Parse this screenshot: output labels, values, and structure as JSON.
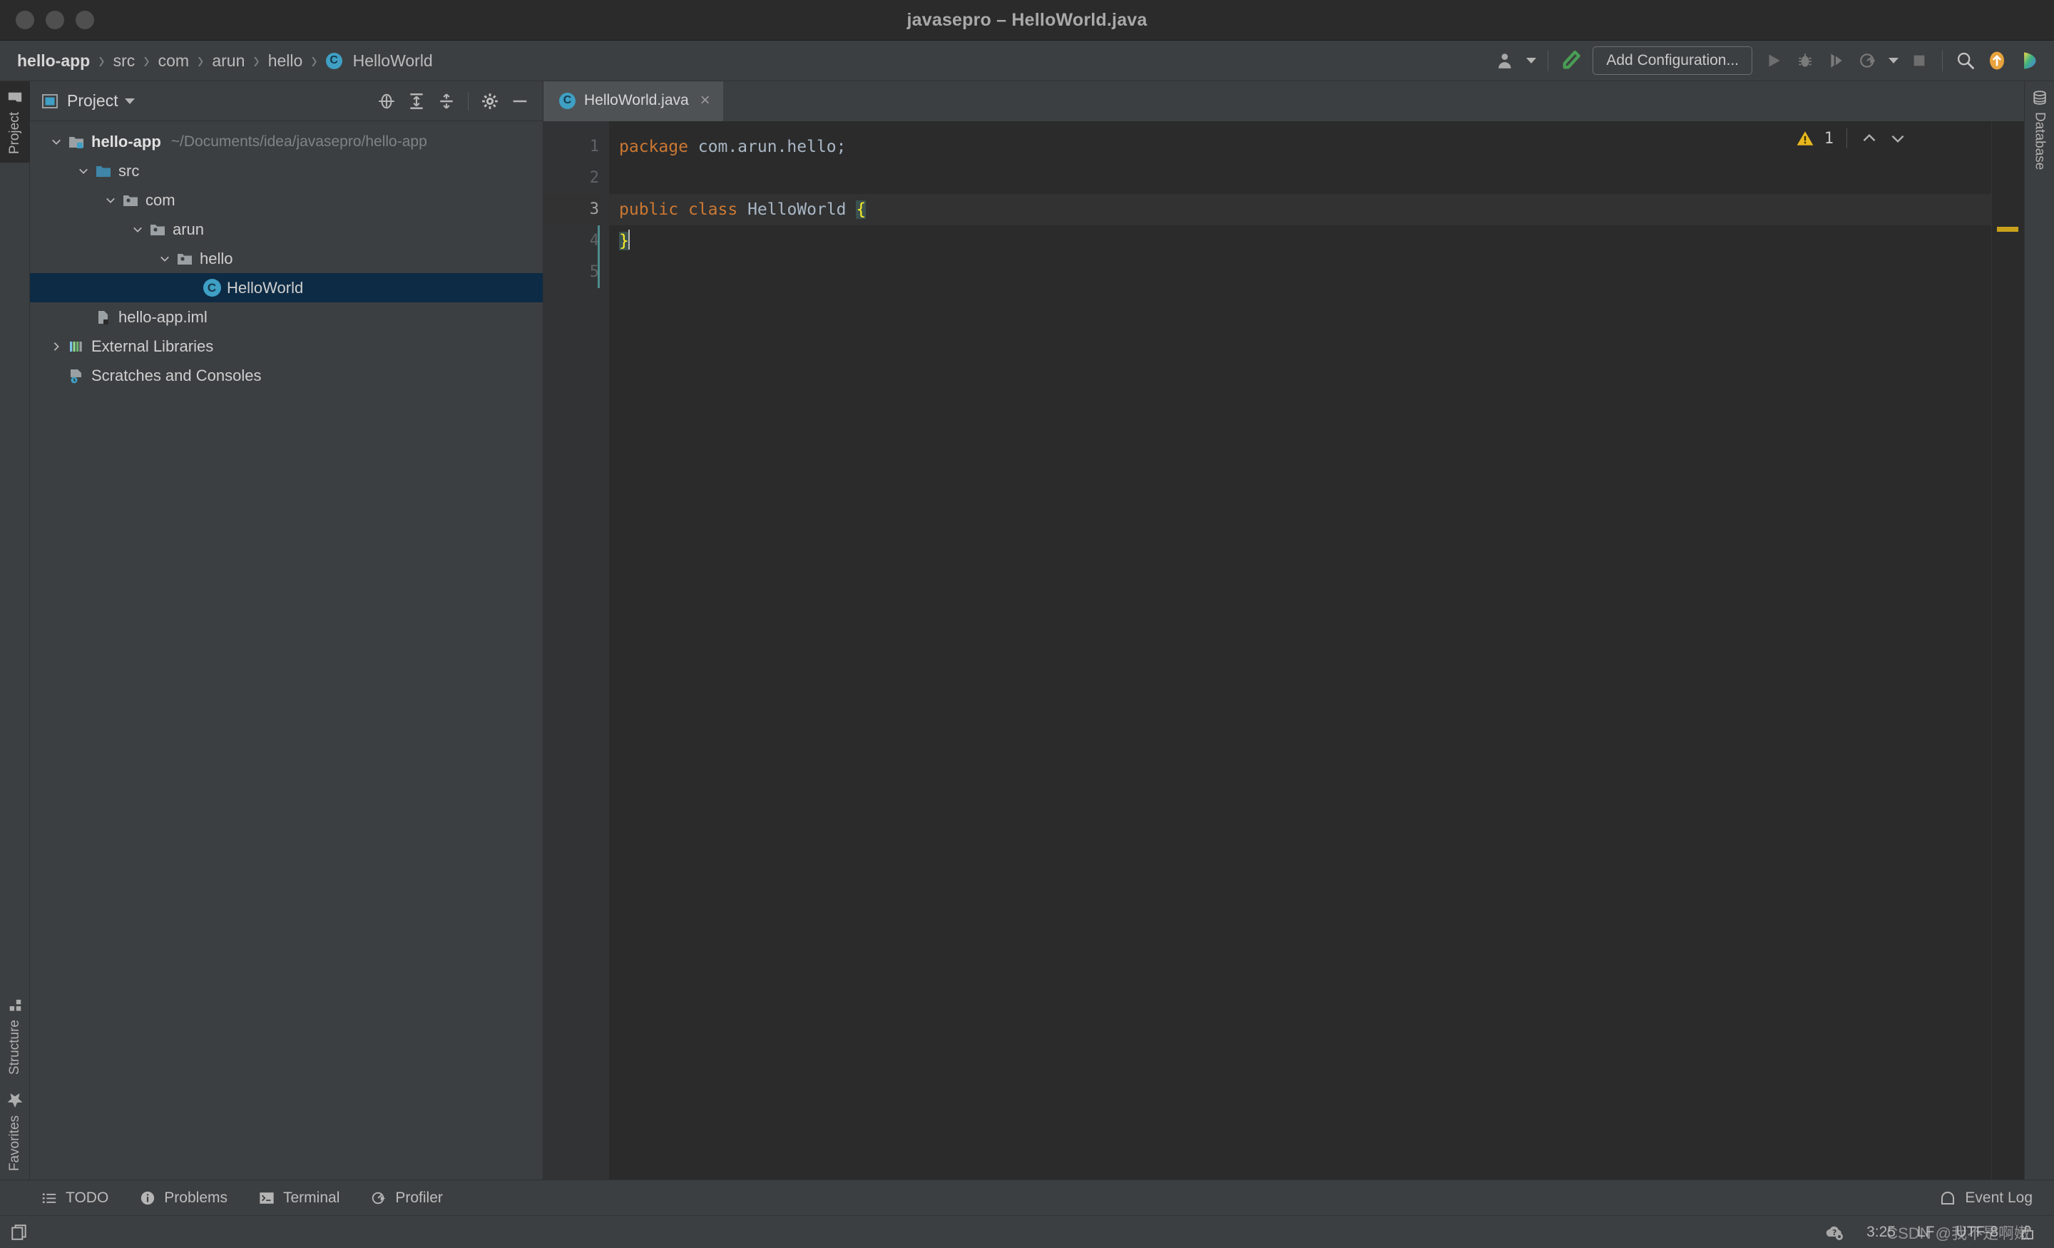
{
  "window": {
    "title": "javasepro – HelloWorld.java",
    "traffic_lights": [
      "close",
      "minimize",
      "zoom"
    ]
  },
  "breadcrumb": {
    "items": [
      {
        "label": "hello-app",
        "icon": "none",
        "bold": true
      },
      {
        "label": "src",
        "icon": "none",
        "bold": false
      },
      {
        "label": "com",
        "icon": "none",
        "bold": false
      },
      {
        "label": "arun",
        "icon": "none",
        "bold": false
      },
      {
        "label": "hello",
        "icon": "none",
        "bold": false
      },
      {
        "label": "HelloWorld",
        "icon": "class-badge",
        "bold": false
      }
    ],
    "separator": "›",
    "class_badge_letter": "C"
  },
  "toolbar": {
    "account_label": "account-icon",
    "build_label": "build-hammer-icon",
    "add_configuration": "Add Configuration...",
    "run_label": "run-icon",
    "debug_label": "debug-icon",
    "run_coverage_label": "run-with-coverage-icon",
    "profile_label": "profile-icon",
    "stop_label": "stop-icon",
    "search_label": "search-everywhere-icon",
    "update_label": "update-icon",
    "ide_label": "ide-icon",
    "accent_green": "#499c54",
    "accent_orange": "#e8a33d"
  },
  "left_stripe": {
    "top": [
      {
        "label": "Project",
        "icon": "folder-icon",
        "active": true
      }
    ],
    "bottom": [
      {
        "label": "Structure",
        "icon": "structure-icon",
        "active": false
      },
      {
        "label": "Favorites",
        "icon": "star-icon",
        "active": false
      }
    ]
  },
  "right_stripe": {
    "items": [
      {
        "label": "Database",
        "icon": "database-icon",
        "active": false
      }
    ]
  },
  "project_panel": {
    "title": "Project",
    "icons": [
      "locate-icon",
      "expand-all-icon",
      "collapse-all-icon",
      "settings-gear-icon",
      "hide-icon"
    ],
    "tree": [
      {
        "label": "hello-app",
        "path": "~/Documents/idea/javasepro/hello-app",
        "icon": "module-icon",
        "depth": 0,
        "arrow": "down",
        "bold": true,
        "selected": false
      },
      {
        "label": "src",
        "path": "",
        "icon": "source-folder-icon",
        "depth": 1,
        "arrow": "down",
        "bold": false,
        "selected": false
      },
      {
        "label": "com",
        "path": "",
        "icon": "package-icon",
        "depth": 2,
        "arrow": "down",
        "bold": false,
        "selected": false
      },
      {
        "label": "arun",
        "path": "",
        "icon": "package-icon",
        "depth": 3,
        "arrow": "down",
        "bold": false,
        "selected": false
      },
      {
        "label": "hello",
        "path": "",
        "icon": "package-icon",
        "depth": 4,
        "arrow": "down",
        "bold": false,
        "selected": false
      },
      {
        "label": "HelloWorld",
        "path": "",
        "icon": "class-icon",
        "depth": 5,
        "arrow": "none",
        "bold": false,
        "selected": true
      },
      {
        "label": "hello-app.iml",
        "path": "",
        "icon": "iml-file-icon",
        "depth": 1,
        "arrow": "none",
        "bold": false,
        "selected": false
      },
      {
        "label": "External Libraries",
        "path": "",
        "icon": "libraries-icon",
        "depth": 0,
        "arrow": "right",
        "bold": false,
        "selected": false
      },
      {
        "label": "Scratches and Consoles",
        "path": "",
        "icon": "scratches-icon",
        "depth": 0,
        "arrow": "none",
        "bold": false,
        "selected": false
      }
    ]
  },
  "editor": {
    "tabs": [
      {
        "label": "HelloWorld.java",
        "icon": "class-icon",
        "badge": "C",
        "close": "×",
        "active": true
      }
    ],
    "line_numbers": [
      "1",
      "2",
      "3",
      "4",
      "5"
    ],
    "current_line": 3,
    "lines": [
      {
        "n": 1,
        "tokens": [
          {
            "t": "package",
            "c": "kw"
          },
          {
            "t": " ",
            "c": "plain"
          },
          {
            "t": "com.arun.hello;",
            "c": "plain"
          }
        ]
      },
      {
        "n": 2,
        "tokens": []
      },
      {
        "n": 3,
        "tokens": [
          {
            "t": "public",
            "c": "kw"
          },
          {
            "t": " ",
            "c": "plain"
          },
          {
            "t": "class",
            "c": "kw"
          },
          {
            "t": " ",
            "c": "plain"
          },
          {
            "t": "HelloWorld",
            "c": "cls"
          },
          {
            "t": " ",
            "c": "plain"
          },
          {
            "t": "{",
            "c": "brace-hl"
          }
        ]
      },
      {
        "n": 4,
        "tokens": [
          {
            "t": "}",
            "c": "brace-hl"
          }
        ]
      },
      {
        "n": 5,
        "tokens": []
      }
    ],
    "inspection": {
      "warning_count": "1",
      "icon": "warning-triangle-icon",
      "up": "prev-highlight-icon",
      "down": "next-highlight-icon"
    },
    "marker_color": "#c9a21b"
  },
  "bottom_toolbar": {
    "items": [
      {
        "label": "TODO",
        "icon": "todo-list-icon"
      },
      {
        "label": "Problems",
        "icon": "problems-icon"
      },
      {
        "label": "Terminal",
        "icon": "terminal-icon"
      },
      {
        "label": "Profiler",
        "icon": "profiler-icon"
      }
    ],
    "right": [
      {
        "label": "Event Log",
        "icon": "event-log-icon"
      }
    ]
  },
  "statusbar": {
    "layout_icon": "layout-icon",
    "cloud_icon": "cloud-settings-icon",
    "caret_position": "3:25",
    "line_separator": "LF",
    "encoding": "UTF-8",
    "lock_icon": "lock-icon",
    "watermark": "CSDN @我不是啊嫩"
  }
}
